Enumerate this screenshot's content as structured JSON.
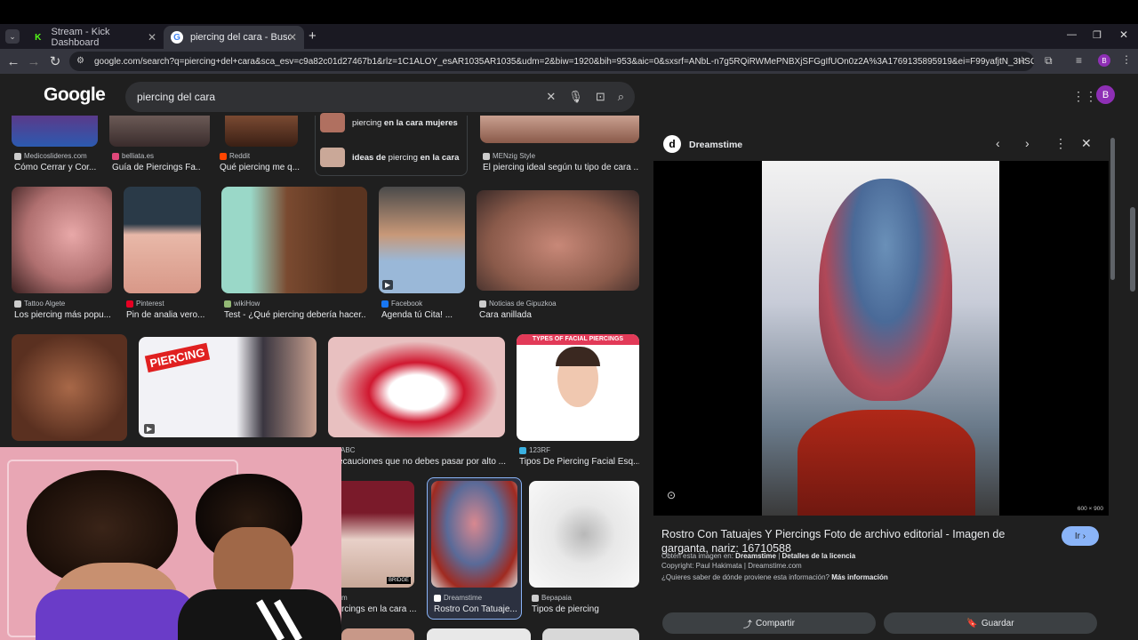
{
  "tabs": [
    {
      "title": "Stream - Kick Dashboard",
      "icon": "kick-icon"
    },
    {
      "title": "piercing del cara - Buscar con G",
      "icon": "google-icon"
    }
  ],
  "address": {
    "url": "google.com/search?q=piercing+del+cara&sca_esv=c9a82c01d27467b1&rlz=1C1ALOY_esAR1035AR1035&udm=2&biw=1920&bih=953&aic=0&sxsrf=ANbL-n7g5RQiRWMePNBXjSFGgIfUOn0z2A%3A1769135895919&ei=F99yafjtN_3HSOUPwrOSwA..."
  },
  "search": {
    "logo": "Google",
    "query": "piercing del cara"
  },
  "profile_initial": "B",
  "suggestions": [
    {
      "pre": "piercing ",
      "bold1": "en la cara ",
      "post": "",
      "bold2": "mujeres"
    },
    {
      "pre": "",
      "bold1": "ideas de ",
      "post": "piercing ",
      "bold2": "en la cara"
    }
  ],
  "results": [
    {
      "source": "Medicoslideres.com",
      "title": "Cómo Cerrar y Cor..."
    },
    {
      "source": "belliata.es",
      "title": "Guía de Piercings Fa..."
    },
    {
      "source": "Reddit",
      "title": "Qué piercing me q..."
    },
    {
      "source": "MENzig Style",
      "title": "El piercing ideal según tu tipo de cara ..."
    },
    {
      "source": "Tattoo Algete",
      "title": "Los piercing más popu..."
    },
    {
      "source": "Pinterest",
      "title": "Pin de analia vero..."
    },
    {
      "source": "wikiHow",
      "title": "Test - ¿Qué piercing debería hacer..."
    },
    {
      "source": "Facebook",
      "title": "Agenda tú Cita! ..."
    },
    {
      "source": "Noticias de Gipuzkoa",
      "title": "Cara anillada"
    },
    {
      "source": "ABC",
      "title": "ecauciones que no debes pasar por alto ..."
    },
    {
      "source": "123RF",
      "title": "Tipos De Piercing Facial Esq..."
    },
    {
      "source": "m",
      "title": "rcings en la cara ..."
    },
    {
      "source": "Dreamstime",
      "title": "Rostro Con Tatuaje..."
    },
    {
      "source": "Bepapaia",
      "title": "Tipos de piercing"
    }
  ],
  "thumb_texts": {
    "piercing": "PIERCING",
    "facial": "TYPES OF FACIAL PIERCINGS",
    "bridge": "BRIDGE"
  },
  "panel": {
    "source": "Dreamstime",
    "title": "Rostro Con Tatuajes Y Piercings Foto de archivo editorial - Imagen de garganta, nariz: 16710588",
    "go_label": "Ir",
    "dims": "600 × 900",
    "obtain_prefix": "Obtén esta imagen en: ",
    "obtain_source": "Dreamstime",
    "obtain_sep": " | ",
    "license": "Detalles de la licencia",
    "copyright": "Copyright: Paul Hakimata | Dreamstime.com",
    "question": "¿Quieres saber de dónde proviene esta información? ",
    "more": "Más información",
    "share": "Compartir",
    "save": "Guardar"
  },
  "colors": {
    "accent": "#8ab4f8",
    "avatar": "#8e2fb5",
    "kick": "#53fc18"
  }
}
